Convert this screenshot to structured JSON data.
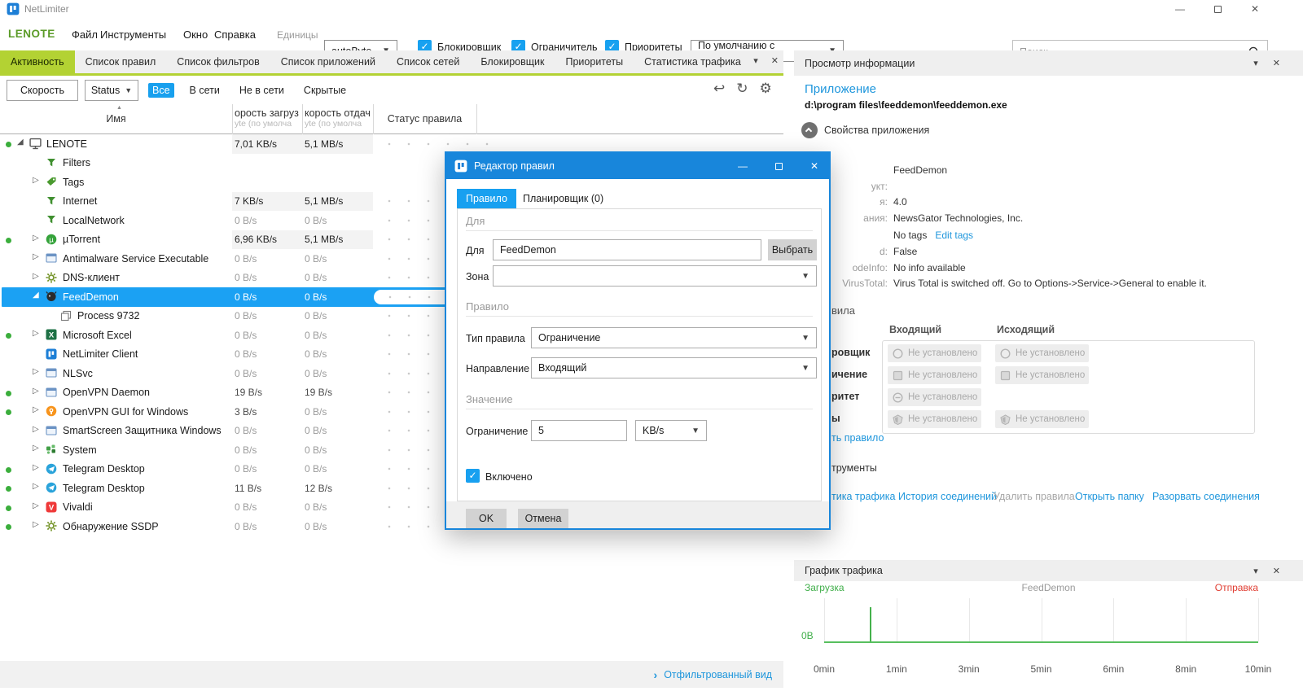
{
  "window": {
    "title": "NetLimiter"
  },
  "menu": {
    "brand": "LENOTE",
    "items": [
      "Файл",
      "Инструменты",
      "Окно",
      "Справка"
    ],
    "units_label": "Единицы",
    "units_value": "autoByte",
    "checkboxes": [
      {
        "label": "Блокировщик",
        "checked": true
      },
      {
        "label": "Ограничитель",
        "checked": true
      },
      {
        "label": "Приоритеты",
        "checked": true
      }
    ],
    "view_value": "По умолчанию с диаграммой",
    "search_placeholder": "Поиск"
  },
  "tabs": [
    "Активность",
    "Список правил",
    "Список фильтров",
    "Список приложений",
    "Список сетей",
    "Блокировщик",
    "Приоритеты",
    "Статистика трафика"
  ],
  "active_tab": "Активность",
  "left_panel": {
    "toolbar": {
      "speed_button": "Скорость",
      "status_dropdown": "Status",
      "filters": [
        "Все",
        "В сети",
        "Не в сети",
        "Скрытые"
      ],
      "active_filter": "Все"
    },
    "columns": {
      "name": "Имя",
      "dl_main": "орость загруз",
      "dl_sub": "yte (по умолча",
      "ul_main": "корость отдач",
      "ul_sub": "yte (по умолча",
      "status": "Статус правила"
    },
    "rows": [
      {
        "name": "LENOTE",
        "icon": "computer",
        "level": 0,
        "arrow": "expanded",
        "online": true,
        "dl": "7,01 KB/s",
        "ul": "5,1 MB/s",
        "shaded": true,
        "dots": true,
        "selected": false
      },
      {
        "name": "Filters",
        "icon": "funnel",
        "level": 1,
        "arrow": "none",
        "online": false,
        "dl": "",
        "ul": "",
        "shaded": false,
        "dots": false,
        "selected": false
      },
      {
        "name": "Tags",
        "icon": "tag",
        "level": 1,
        "arrow": "collapsed",
        "online": false,
        "dl": "",
        "ul": "",
        "shaded": false,
        "dots": false,
        "selected": false
      },
      {
        "name": "Internet",
        "icon": "funnel",
        "level": 1,
        "arrow": "none",
        "online": false,
        "dl": "7 KB/s",
        "ul": "5,1 MB/s",
        "shaded": true,
        "dots": true,
        "selected": false
      },
      {
        "name": "LocalNetwork",
        "icon": "funnel",
        "level": 1,
        "arrow": "none",
        "online": false,
        "dl": "0 B/s",
        "ul": "0 B/s",
        "shaded": false,
        "dots": true,
        "selected": false
      },
      {
        "name": "µTorrent",
        "icon": "utorrent",
        "level": 1,
        "arrow": "collapsed",
        "online": true,
        "dl": "6,96 KB/s",
        "ul": "5,1 MB/s",
        "shaded": true,
        "dots": true,
        "selected": false
      },
      {
        "name": "Antimalware Service Executable",
        "icon": "window",
        "level": 1,
        "arrow": "collapsed",
        "online": false,
        "dl": "0 B/s",
        "ul": "0 B/s",
        "shaded": false,
        "dots": true,
        "selected": false
      },
      {
        "name": "DNS-клиент",
        "icon": "gear",
        "level": 1,
        "arrow": "collapsed",
        "online": false,
        "dl": "0 B/s",
        "ul": "0 B/s",
        "shaded": false,
        "dots": true,
        "selected": false
      },
      {
        "name": "FeedDemon",
        "icon": "feeddemon",
        "level": 1,
        "arrow": "expanded",
        "online": false,
        "dl": "0 B/s",
        "ul": "0 B/s",
        "shaded": false,
        "dots": true,
        "selected": true
      },
      {
        "name": "Process 9732",
        "icon": "process",
        "level": 2,
        "arrow": "none",
        "online": false,
        "dl": "0 B/s",
        "ul": "0 B/s",
        "shaded": false,
        "dots": true,
        "selected": false
      },
      {
        "name": "Microsoft Excel",
        "icon": "excel",
        "level": 1,
        "arrow": "collapsed",
        "online": true,
        "dl": "0 B/s",
        "ul": "0 B/s",
        "shaded": false,
        "dots": true,
        "selected": false
      },
      {
        "name": "NetLimiter Client",
        "icon": "netlimiter",
        "level": 1,
        "arrow": "none",
        "online": false,
        "dl": "0 B/s",
        "ul": "0 B/s",
        "shaded": false,
        "dots": true,
        "selected": false
      },
      {
        "name": "NLSvc",
        "icon": "window",
        "level": 1,
        "arrow": "collapsed",
        "online": false,
        "dl": "0 B/s",
        "ul": "0 B/s",
        "shaded": false,
        "dots": true,
        "selected": false
      },
      {
        "name": "OpenVPN Daemon",
        "icon": "window",
        "level": 1,
        "arrow": "collapsed",
        "online": true,
        "dl": "19 B/s",
        "ul": "19 B/s",
        "shaded": false,
        "dots": true,
        "selected": false
      },
      {
        "name": "OpenVPN GUI for Windows",
        "icon": "openvpn",
        "level": 1,
        "arrow": "collapsed",
        "online": true,
        "dl": "3 B/s",
        "ul": "0 B/s",
        "shaded": false,
        "dots": true,
        "selected": false
      },
      {
        "name": "SmartScreen Защитника Windows",
        "icon": "window",
        "level": 1,
        "arrow": "collapsed",
        "online": false,
        "dl": "0 B/s",
        "ul": "0 B/s",
        "shaded": false,
        "dots": true,
        "selected": false
      },
      {
        "name": "System",
        "icon": "system",
        "level": 1,
        "arrow": "collapsed",
        "online": false,
        "dl": "0 B/s",
        "ul": "0 B/s",
        "shaded": false,
        "dots": true,
        "selected": false
      },
      {
        "name": "Telegram Desktop",
        "icon": "telegram",
        "level": 1,
        "arrow": "collapsed",
        "online": true,
        "dl": "0 B/s",
        "ul": "0 B/s",
        "shaded": false,
        "dots": true,
        "selected": false
      },
      {
        "name": "Telegram Desktop",
        "icon": "telegram",
        "level": 1,
        "arrow": "collapsed",
        "online": true,
        "dl": "11 B/s",
        "ul": "12 B/s",
        "shaded": false,
        "dots": true,
        "selected": false
      },
      {
        "name": "Vivaldi",
        "icon": "vivaldi",
        "level": 1,
        "arrow": "collapsed",
        "online": true,
        "dl": "0 B/s",
        "ul": "0 B/s",
        "shaded": false,
        "dots": true,
        "selected": false
      },
      {
        "name": "Обнаружение SSDP",
        "icon": "gear",
        "level": 1,
        "arrow": "collapsed",
        "online": true,
        "dl": "0 B/s",
        "ul": "0 B/s",
        "shaded": false,
        "dots": true,
        "selected": false
      }
    ],
    "status_bar_link": "Отфильтрованный вид"
  },
  "info_panel": {
    "header": "Просмотр информации",
    "app_heading": "Приложение",
    "app_path": "d:\\program files\\feeddemon\\feeddemon.exe",
    "section_title": "Свойства приложения",
    "properties": [
      {
        "label": "",
        "value": "FeedDemon",
        "link": ""
      },
      {
        "label": "укт:",
        "value": "",
        "link": ""
      },
      {
        "label": "я:",
        "value": "4.0",
        "link": ""
      },
      {
        "label": "ания:",
        "value": "NewsGator Technologies, Inc.",
        "link": ""
      },
      {
        "label": "",
        "value": "No tags",
        "link": "Edit tags"
      },
      {
        "label": "d:",
        "value": "False",
        "link": ""
      },
      {
        "label": "odeInfo:",
        "value": "No info available",
        "link": ""
      },
      {
        "label": "VirusTotal:",
        "value": "Virus Total is switched off. Go to Options->Service->General to enable it.",
        "link": ""
      }
    ],
    "rules_section_fragment": "вила",
    "rules_headers": [
      "Входящий",
      "Исходящий"
    ],
    "not_set_text": "Не установлено",
    "rules_rows": [
      {
        "label_fragment": "ровщик",
        "icon": "circle",
        "cells": 2
      },
      {
        "label_fragment": "ичение",
        "icon": "square",
        "cells": 2
      },
      {
        "label_fragment": "ритет",
        "icon": "circle-minus",
        "cells": 1
      },
      {
        "label_fragment": "ы",
        "icon": "shield",
        "cells": 2
      }
    ],
    "add_rule_link_fragment": "ть правило",
    "tools_header_fragment": "трументы",
    "tool_links": [
      {
        "label": "тика трафика",
        "enabled": true
      },
      {
        "label": "История соединений",
        "enabled": true
      },
      {
        "label": "Удалить правила",
        "enabled": false
      },
      {
        "label": "Открыть папку",
        "enabled": true
      },
      {
        "label": "Разорвать соединения",
        "enabled": true
      }
    ]
  },
  "traffic_chart": {
    "header": "График трафика",
    "chart_data": {
      "type": "line",
      "title": "FeedDemon",
      "legend": [
        {
          "label": "Загрузка",
          "color": "#3fae49",
          "position": "left"
        },
        {
          "label": "FeedDemon",
          "color": "#9a9a9a",
          "position": "center"
        },
        {
          "label": "Отправка",
          "color": "#e03c31",
          "position": "right"
        }
      ],
      "x_ticks": [
        "0min",
        "1min",
        "3min",
        "5min",
        "6min",
        "8min",
        "10min"
      ],
      "y_base_label": "0B",
      "series": [
        {
          "name": "Загрузка",
          "color": "#3fae49",
          "values_minutes": [
            0,
            0.6,
            1,
            3,
            5,
            6,
            8,
            10
          ],
          "values": [
            0,
            1,
            0,
            0,
            0,
            0,
            0,
            0
          ],
          "note": "flat at 0 B with a single spike near 0.6min"
        },
        {
          "name": "Отправка",
          "color": "#e03c31",
          "values_minutes": [
            0,
            10
          ],
          "values": [
            0,
            0
          ],
          "note": "flat at 0 B"
        }
      ],
      "spike_fraction_x": 0.105,
      "grid": true
    }
  },
  "dialog": {
    "title": "Редактор правил",
    "tabs": [
      {
        "label": "Правило",
        "active": true
      },
      {
        "label": "Планировщик (0)",
        "active": false
      }
    ],
    "section_for": "Для",
    "for_label": "Для",
    "for_value": "FeedDemon",
    "choose_button": "Выбрать",
    "zone_label": "Зона",
    "zone_value": "",
    "section_rule": "Правило",
    "rule_type_label": "Тип правила",
    "rule_type_value": "Ограничение",
    "direction_label": "Направление",
    "direction_value": "Входящий",
    "section_value": "Значение",
    "limit_label": "Ограничение",
    "limit_value": "5",
    "unit_value": "KB/s",
    "enabled_label": "Включено",
    "enabled_checked": true,
    "ok_button": "OK",
    "cancel_button": "Отмена"
  },
  "colors": {
    "accent_blue": "#18a0f0",
    "selection_blue": "#1ba1f3",
    "tab_green": "#b3d233",
    "brand_green": "#5b9b28",
    "link_blue": "#1e96dc",
    "chart_green": "#3fae49",
    "chart_red": "#e03c31",
    "dialog_title_blue": "#1886db"
  }
}
